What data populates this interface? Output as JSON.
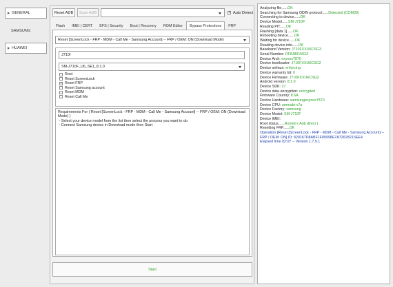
{
  "colors": {
    "ok": "#2aa12a",
    "value": "#2aa12a",
    "info": "#1a3fae",
    "text": "#222222"
  },
  "sidebar": {
    "items": [
      {
        "label": "GENERAL",
        "arrow": true
      },
      {
        "label": "SAMSUNG",
        "arrow": false
      },
      {
        "label": "HUAWEI",
        "arrow": true
      }
    ]
  },
  "toolbar": {
    "reset_adb": "Reset ADB",
    "scan_adb": "Scan ADB",
    "auto_detect": "Auto Detect",
    "auto_detect_checked": true
  },
  "tabs": [
    "Flash",
    "IMEI | CERT",
    "EFS | Security",
    "Boot | Recovery",
    "ROM Editor",
    "Bypass Protections",
    "FRP"
  ],
  "active_tab": 5,
  "bypass": {
    "operation_select": "Reset [ScreenLock - FRP - MDM - Call Me - Samsung Account] -- FRP / OEM: ON (Download Mode)",
    "model_input": "J710f",
    "firmware_select": "SM-J710F_U6_SE1_8.1.0",
    "options": [
      {
        "label": "Root",
        "checked": false
      },
      {
        "label": "Reset ScreenLock",
        "checked": false
      },
      {
        "label": "Reset FRP",
        "checked": true
      },
      {
        "label": "Reset Samsung account",
        "checked": false
      },
      {
        "label": "Reset MDM",
        "checked": false
      },
      {
        "label": "Reset Call Me",
        "checked": false
      }
    ],
    "requirements": [
      "Requirements For ( Reset [ScreenLock - FRP - MDM - Call Me - Samsung Account] -- FRP / OEM: ON (Download Mode) )",
      " - Select your device model from the list then select the process you want to do",
      " - Connect Samsung device in Download mode then Start"
    ]
  },
  "start_label": "Start",
  "log": [
    {
      "text": "Analyzing file......",
      "value": "OK",
      "type": "ok"
    },
    {
      "text": "Searching for Samsung ODIN protocol......",
      "value": "Detected (COM39)",
      "type": "ok"
    },
    {
      "text": "Connecting to device......",
      "value": "OK",
      "type": "ok"
    },
    {
      "text": "Device Model......",
      "value": "SM-J710F",
      "type": "ok"
    },
    {
      "text": "Reading PIT......",
      "value": "OK",
      "type": "ok"
    },
    {
      "text": "Flashing [data 1]......",
      "value": "OK",
      "type": "ok"
    },
    {
      "text": "Rebooting device......",
      "value": "OK",
      "type": "ok"
    },
    {
      "text": "Waiting for device......",
      "value": "OK",
      "type": "ok"
    },
    {
      "text": "Reading device info......",
      "value": "OK",
      "type": "ok"
    },
    {
      "text": "Baseband Version: ",
      "value": "J710FXXU6CSG3",
      "type": "ok"
    },
    {
      "text": "Serial Number: ",
      "value": "RF8J801502Z",
      "type": "ok"
    },
    {
      "text": "Device Arch: ",
      "value": "exynos7870",
      "type": "ok"
    },
    {
      "text": "Device bootloader: ",
      "value": "J710FXXU6CSG2",
      "type": "ok"
    },
    {
      "text": "Device selinux: ",
      "value": "enforcing",
      "type": "ok"
    },
    {
      "text": "Device warranty bit: ",
      "value": "0",
      "type": "ok"
    },
    {
      "text": "Device Firmware: ",
      "value": "J710FXXU6CSG2",
      "type": "ok"
    },
    {
      "text": "Android version: ",
      "value": "8.1.0",
      "type": "ok"
    },
    {
      "text": "Device SDK: ",
      "value": "27",
      "type": "ok"
    },
    {
      "text": "Device data encryption: ",
      "value": "encrypted",
      "type": "ok"
    },
    {
      "text": "Firmware Country: ",
      "value": "KSA",
      "type": "ok"
    },
    {
      "text": "Device Hardware: ",
      "value": "samsungexynos7870",
      "type": "ok"
    },
    {
      "text": "Device CPU: ",
      "value": "armeabi-v7a",
      "type": "ok"
    },
    {
      "text": "Device Factory: ",
      "value": "samsung",
      "type": "ok"
    },
    {
      "text": "Device Model: ",
      "value": "SM-J710F",
      "type": "ok"
    },
    {
      "text": "Device IMEI: ",
      "value": "",
      "type": "ok"
    },
    {
      "text": "Root status......",
      "value": "Rooted ( Adb direct )",
      "type": "ok"
    },
    {
      "text": "Resetting FRP......",
      "value": "OK",
      "type": "ok"
    },
    {
      "text": "Operation [Reset [ScreenLock - FRP - MDM - Call Me - Samsung Account] -- FRP / OEM: ON] ID: 829167D8ABF1F89998E7A7261B213EE4",
      "value": "",
      "type": "info"
    },
    {
      "text": "Elapsed time 02:07 -- Version 1.7.9.1",
      "value": "",
      "type": "info"
    }
  ]
}
